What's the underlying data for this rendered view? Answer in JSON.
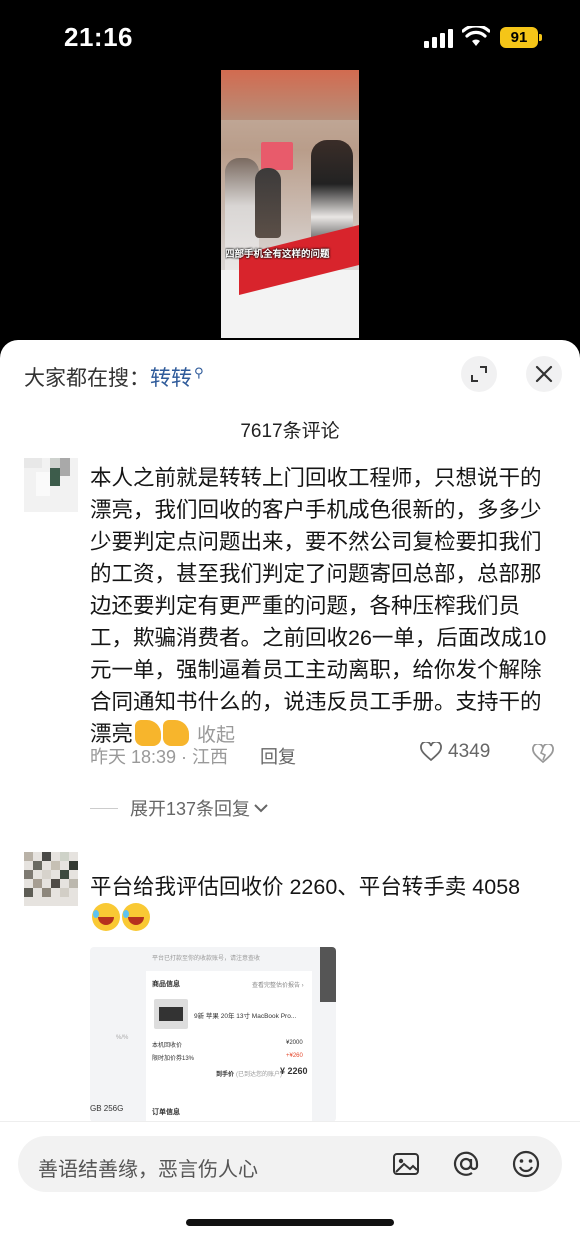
{
  "status_bar": {
    "time": "21:16",
    "battery": "91"
  },
  "video": {
    "caption": "四部手机全有这样的问题"
  },
  "sheet": {
    "search_hint_prefix": "大家都在搜：",
    "search_keyword": "转转",
    "comment_count": "7617条评论"
  },
  "comments": [
    {
      "text": "本人之前就是转转上门回收工程师，只想说干的漂亮，我们回收的客户手机成色很新的，多多少少要判定点问题出来，要不然公司复检要扣我们的工资，甚至我们判定了问题寄回总部，总部那边还要判定有更严重的问题，各种压榨我们员工，欺骗消费者。之前回收26一单，后面改成10元一单，强制逼着员工主动离职，给你发个解除合同通知书什么的，说违反员工手册。支持干的漂亮",
      "fold_label": "收起",
      "time_location": "昨天 18:39 · 江西",
      "reply_label": "回复",
      "likes": "4349",
      "expand_replies": "展开137条回复"
    },
    {
      "text": "平台给我评估回收价 2260、平台转手卖 4058",
      "attachment": {
        "top_note": "平台已打款至你的收款账号，请注意查收",
        "section_title": "商品信息",
        "link_text": "查看完整估价报告 ›",
        "product": "9新 苹果 20年 13寸 MacBook Pro...",
        "row1_label": "本机回收价",
        "row1_value": "¥2000",
        "row2_label": "限时加价券13%",
        "row2_value": "+¥260",
        "total_label": "到手价",
        "total_note": "(已到达您的账户)",
        "total_value": "¥ 2260",
        "order_title": "订单信息",
        "side_left_1": "%/%",
        "side_left_2": "GB 256G"
      }
    }
  ],
  "input": {
    "placeholder": "善语结善缘，恶言伤人心"
  }
}
